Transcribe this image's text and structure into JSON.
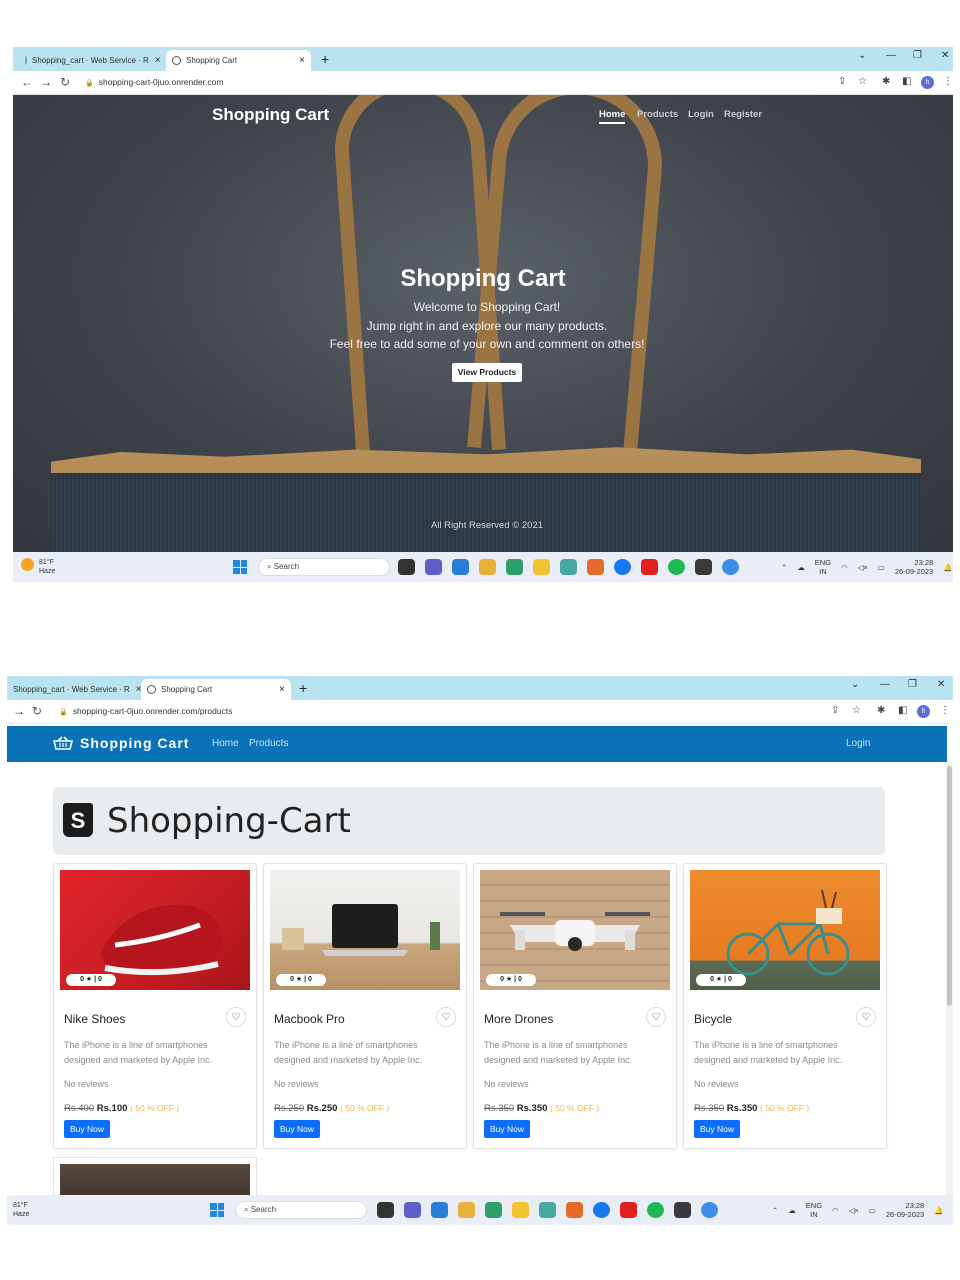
{
  "shot1": {
    "tabs": [
      {
        "label": "Shopping_cart · Web Service · R",
        "close": "×"
      },
      {
        "label": "Shopping Cart",
        "close": "×"
      }
    ],
    "new_tab": "+",
    "url": "shopping-cart-0juo.onrender.com",
    "hero": {
      "brand": "Shopping Cart",
      "nav": [
        "Home",
        "Products",
        "Login",
        "Register"
      ],
      "active_nav": "Home",
      "title": "Shopping Cart",
      "lines": [
        "Welcome to Shopping Cart!",
        "Jump right in and explore our many products.",
        "Feel free to add some of your own and comment on others!"
      ],
      "button": "View Products",
      "footer": "All Right Reserved © 2021"
    },
    "taskbar": {
      "temp": "81°F",
      "weather": "Haze",
      "search": "Search",
      "lang1": "ENG",
      "lang2": "IN",
      "time": "23:28",
      "date": "26-09-2023"
    }
  },
  "shot2": {
    "tabs": [
      {
        "label": "Shopping_cart · Web Service · R",
        "close": "×"
      },
      {
        "label": "Shopping Cart",
        "close": "×"
      }
    ],
    "new_tab": "+",
    "url": "shopping-cart-0juo.onrender.com/products",
    "navbar": {
      "brand": "Shopping Cart",
      "links": [
        "Home",
        "Products"
      ],
      "login": "Login"
    },
    "jumbotron": {
      "logo_letter": "S",
      "title": "Shopping-Cart"
    },
    "products": [
      {
        "name": "Nike Shoes",
        "rating": "0 ★ | 0",
        "desc": "The iPhone is a line of smartphones designed and marketed by Apple Inc.",
        "reviews": "No reviews",
        "old_price": "Rs.400",
        "price": "Rs.100",
        "discount": "( 50 % OFF )",
        "buy": "Buy Now"
      },
      {
        "name": "Macbook Pro",
        "rating": "0 ★ | 0",
        "desc": "The iPhone is a line of smartphones designed and marketed by Apple Inc.",
        "reviews": "No reviews",
        "old_price": "Rs.250",
        "price": "Rs.250",
        "discount": "( 50 % OFF )",
        "buy": "Buy Now"
      },
      {
        "name": "More Drones",
        "rating": "0 ★ | 0",
        "desc": "The iPhone is a line of smartphones designed and marketed by Apple Inc.",
        "reviews": "No reviews",
        "old_price": "Rs.350",
        "price": "Rs.350",
        "discount": "( 50 % OFF )",
        "buy": "Buy Now"
      },
      {
        "name": "Bicycle",
        "rating": "0 ★ | 0",
        "desc": "The iPhone is a line of smartphones designed and marketed by Apple Inc.",
        "reviews": "No reviews",
        "old_price": "Rs.350",
        "price": "Rs.350",
        "discount": "( 50 % OFF )",
        "buy": "Buy Now"
      }
    ],
    "taskbar": {
      "temp": "81°F",
      "weather": "Haze",
      "search": "Search",
      "lang1": "ENG",
      "lang2": "IN",
      "time": "23:28",
      "date": "26-09-2023"
    }
  },
  "colors": {
    "tabbar": "#b9e3ef",
    "navbar": "#0a72b9",
    "button": "#0d6efd",
    "discount": "#f3b548"
  }
}
